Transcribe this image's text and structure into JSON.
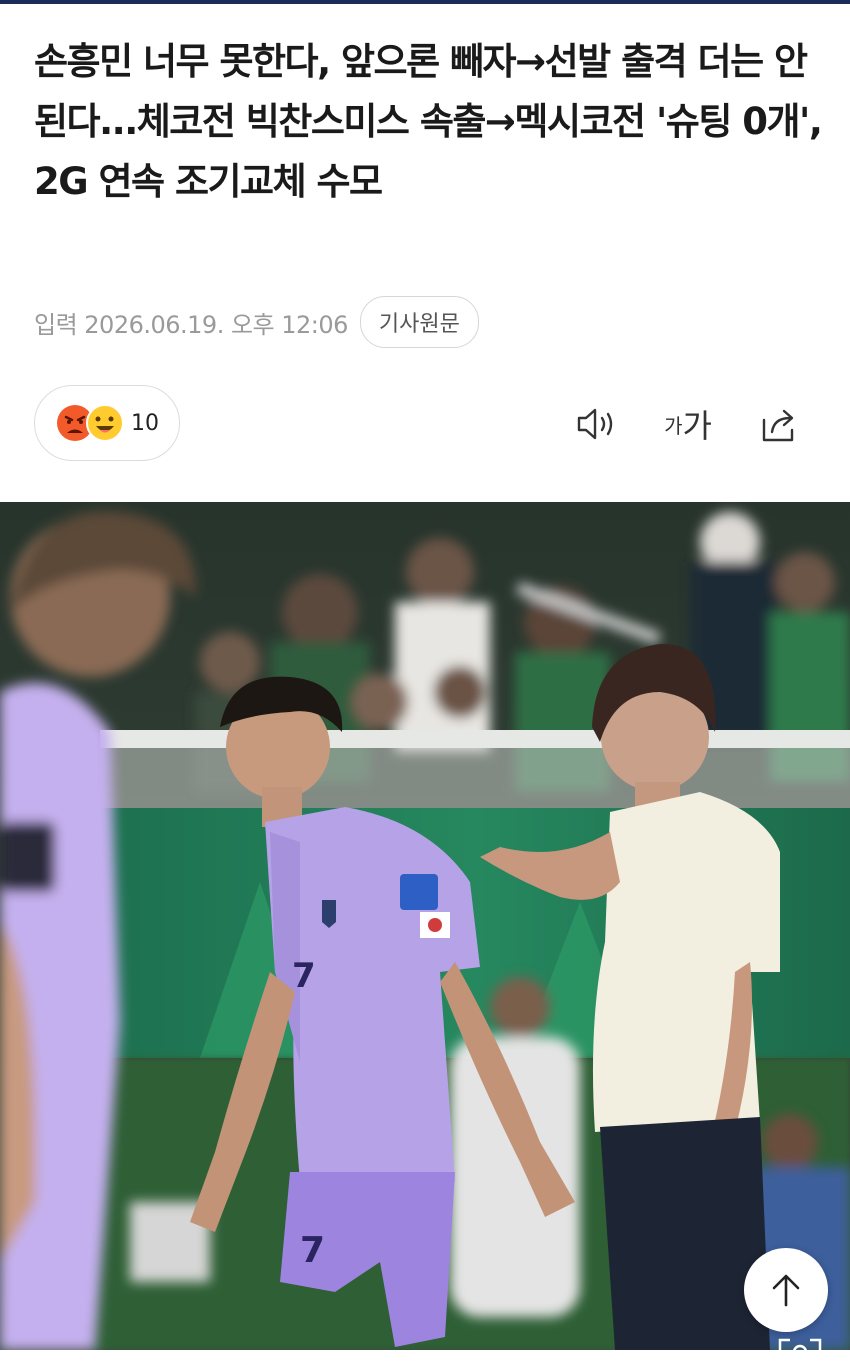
{
  "article": {
    "title": "손흥민 너무 못한다, 앞으론 빼자→선발 출격 더는 안된다...체코전 빅찬스미스 속출→멕시코전 '슈팅 0개', 2G 연속 조기교체 수모",
    "date": "입력 2026.06.19. 오후 12:06",
    "origin_button": "기사원문"
  },
  "reactions": {
    "count": "10",
    "icons": [
      "angry-face-icon",
      "grinning-face-icon"
    ]
  },
  "toolbar": {
    "listen_icon": "speaker-icon",
    "font_small": "가",
    "font_large": "가",
    "share_icon": "share-icon"
  },
  "photo": {
    "description_icon": "news-photo",
    "scroll_top_icon": "arrow-up-icon"
  },
  "colors": {
    "topbar": "#1c2b5a",
    "pitch_green": "#1f7a55",
    "jersey_purple": "#b9a6e8",
    "shorts_purple": "#9d84e0"
  }
}
